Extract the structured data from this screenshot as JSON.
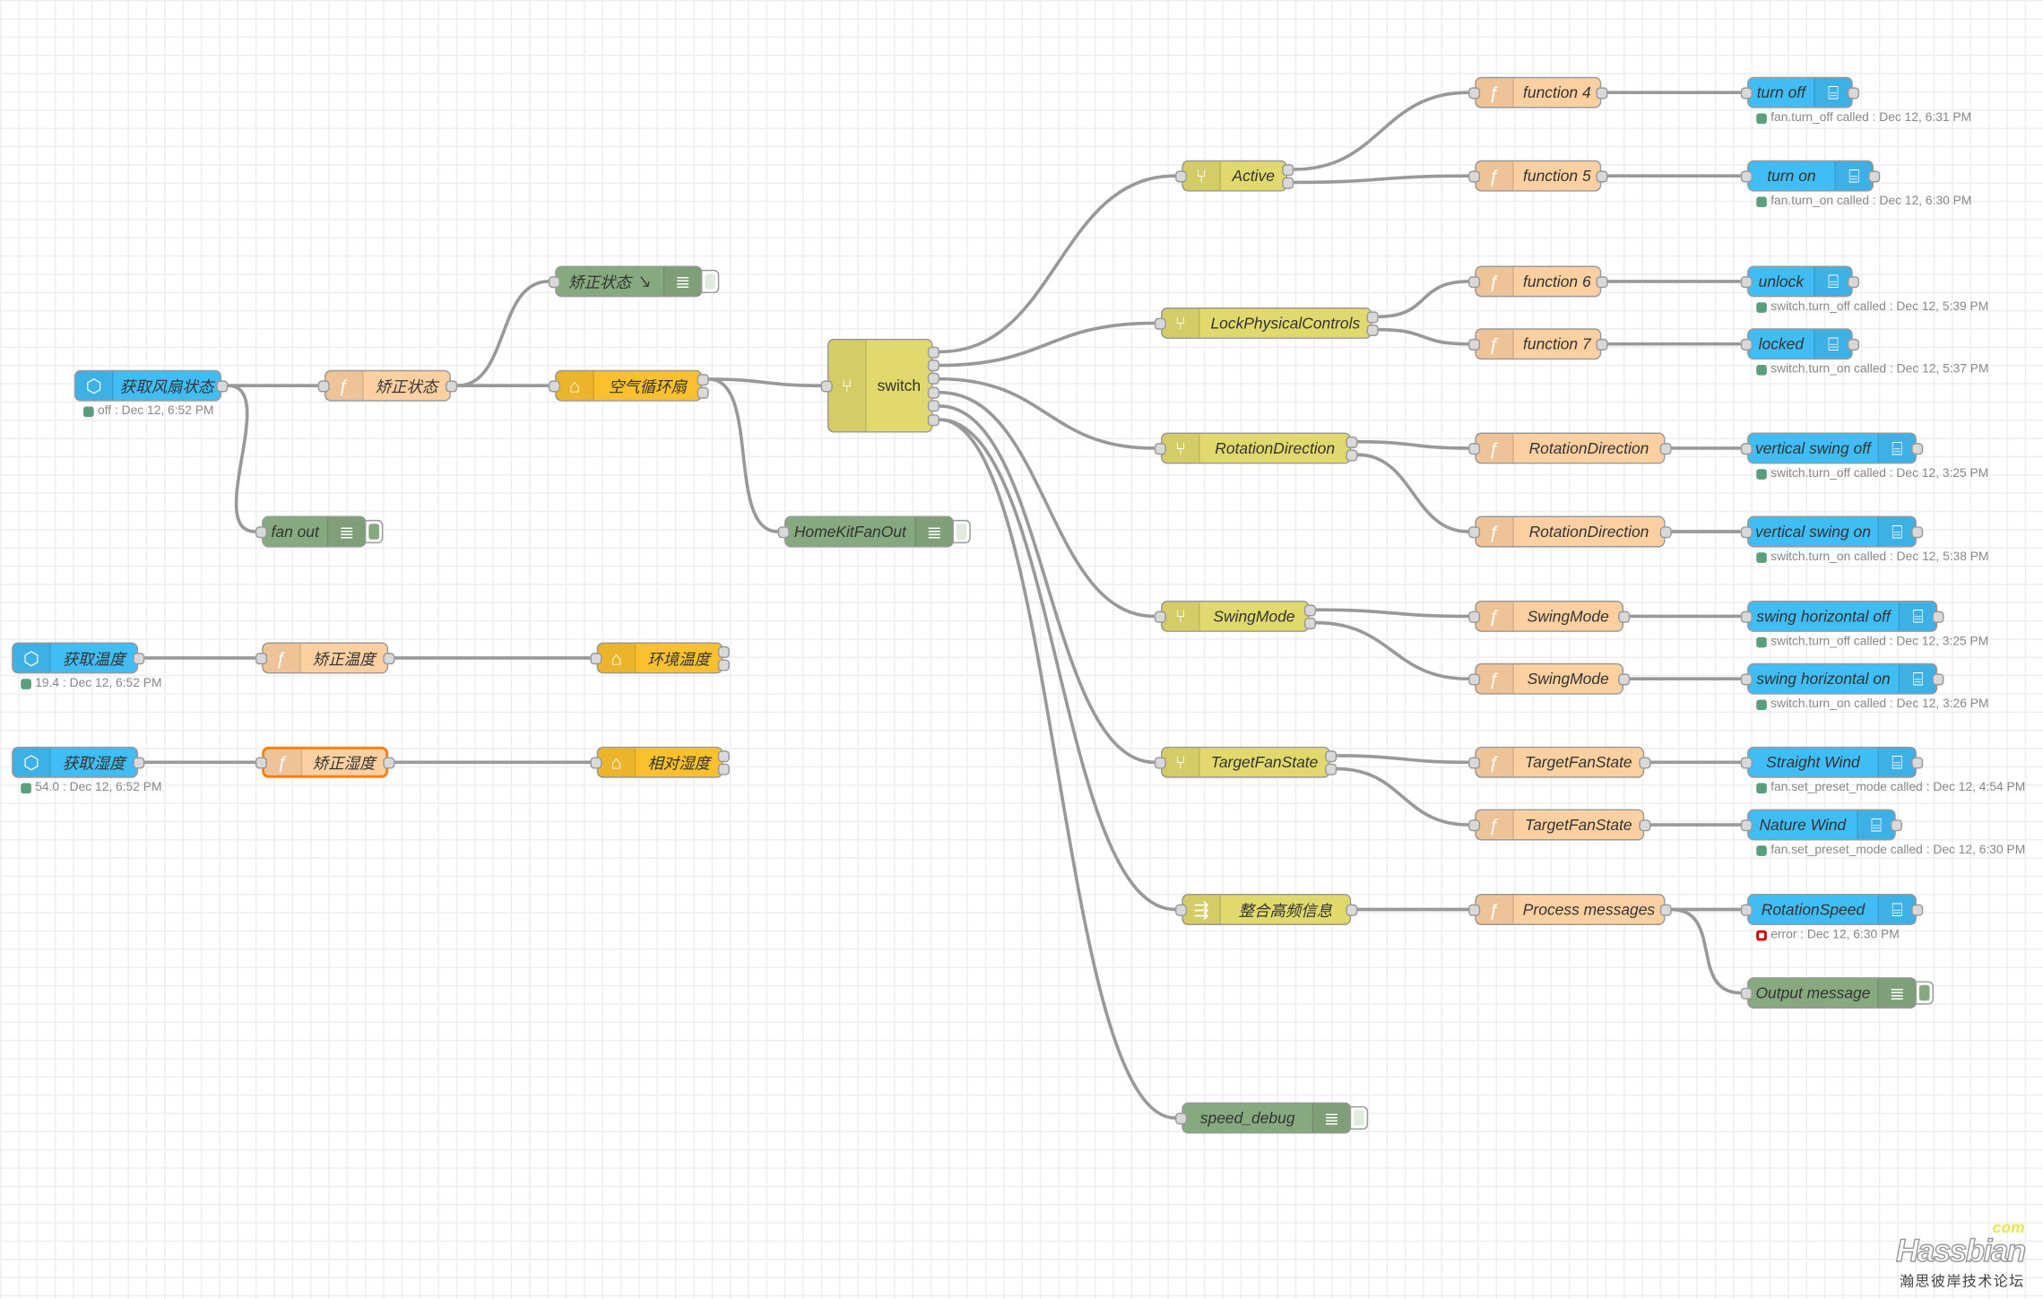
{
  "colors": {
    "ha_blue": "#41bdf5",
    "function": "#fdd0a2",
    "debug": "#87a980",
    "switch": "#e2d96e",
    "homekit": "#fbc02d",
    "wire": "#999999",
    "status_ok": "#5a9e7c",
    "status_error": "#cc0000"
  },
  "nodes": [
    {
      "id": "n1",
      "type": "ha-state",
      "icon": "ha-logo-icon",
      "label": "获取风扇状态",
      "status": "off : Dec 12, 6:52 PM",
      "status_kind": "ok"
    },
    {
      "id": "n2",
      "type": "function",
      "icon": "function-icon",
      "label": "矫正状态"
    },
    {
      "id": "n3",
      "type": "debug",
      "icon": "list-icon",
      "label": "矫正状态 ↘",
      "debug_active": false
    },
    {
      "id": "n4",
      "type": "homekit",
      "icon": "home-icon",
      "label": "空气循环扇"
    },
    {
      "id": "n5",
      "type": "debug",
      "icon": "list-icon",
      "label": "fan out",
      "debug_active": true
    },
    {
      "id": "n6",
      "type": "debug",
      "icon": "list-icon",
      "label": "HomeKitFanOut",
      "debug_active": false
    },
    {
      "id": "n7",
      "type": "ha-state",
      "icon": "ha-logo-icon",
      "label": "获取温度",
      "status": "19.4 : Dec 12, 6:52 PM",
      "status_kind": "ok"
    },
    {
      "id": "n8",
      "type": "function",
      "icon": "function-icon",
      "label": "矫正温度"
    },
    {
      "id": "n9",
      "type": "homekit",
      "icon": "home-icon",
      "label": "环境温度"
    },
    {
      "id": "n10",
      "type": "ha-state",
      "icon": "ha-logo-icon",
      "label": "获取湿度",
      "status": "54.0 : Dec 12, 6:52 PM",
      "status_kind": "ok"
    },
    {
      "id": "n11",
      "type": "function",
      "icon": "function-icon",
      "label": "矫正湿度",
      "selected": true
    },
    {
      "id": "n12",
      "type": "homekit",
      "icon": "home-icon",
      "label": "相对湿度"
    },
    {
      "id": "sw",
      "type": "switch",
      "icon": "switch-icon",
      "label": "switch"
    },
    {
      "id": "s1",
      "type": "switch",
      "icon": "switch-icon",
      "label": "Active"
    },
    {
      "id": "s2",
      "type": "switch",
      "icon": "switch-icon",
      "label": "LockPhysicalControls"
    },
    {
      "id": "s3",
      "type": "switch",
      "icon": "switch-icon",
      "label": "RotationDirection"
    },
    {
      "id": "s4",
      "type": "switch",
      "icon": "switch-icon",
      "label": "SwingMode"
    },
    {
      "id": "s5",
      "type": "switch",
      "icon": "switch-icon",
      "label": "TargetFanState"
    },
    {
      "id": "s6",
      "type": "switch",
      "icon": "join-icon",
      "label": "整合高频信息"
    },
    {
      "id": "d1",
      "type": "debug",
      "icon": "list-icon",
      "label": "speed_debug",
      "debug_active": false
    },
    {
      "id": "f4",
      "type": "function",
      "icon": "function-icon",
      "label": "function 4"
    },
    {
      "id": "f5",
      "type": "function",
      "icon": "function-icon",
      "label": "function 5"
    },
    {
      "id": "f6",
      "type": "function",
      "icon": "function-icon",
      "label": "function 6"
    },
    {
      "id": "f7",
      "type": "function",
      "icon": "function-icon",
      "label": "function 7"
    },
    {
      "id": "f8",
      "type": "function",
      "icon": "function-icon",
      "label": "RotationDirection"
    },
    {
      "id": "f9",
      "type": "function",
      "icon": "function-icon",
      "label": "RotationDirection"
    },
    {
      "id": "f10",
      "type": "function",
      "icon": "function-icon",
      "label": "SwingMode"
    },
    {
      "id": "f11",
      "type": "function",
      "icon": "function-icon",
      "label": "SwingMode"
    },
    {
      "id": "f12",
      "type": "function",
      "icon": "function-icon",
      "label": "TargetFanState"
    },
    {
      "id": "f13",
      "type": "function",
      "icon": "function-icon",
      "label": "TargetFanState"
    },
    {
      "id": "f14",
      "type": "function",
      "icon": "function-icon",
      "label": "Process messages"
    },
    {
      "id": "h1",
      "type": "ha-service",
      "icon": "router-icon",
      "label": "turn off",
      "status": "fan.turn_off called : Dec 12, 6:31 PM",
      "status_kind": "ok"
    },
    {
      "id": "h2",
      "type": "ha-service",
      "icon": "router-icon",
      "label": "turn on",
      "status": "fan.turn_on called : Dec 12, 6:30 PM",
      "status_kind": "ok"
    },
    {
      "id": "h3",
      "type": "ha-service",
      "icon": "router-icon",
      "label": "unlock",
      "status": "switch.turn_off called : Dec 12, 5:39 PM",
      "status_kind": "ok"
    },
    {
      "id": "h4",
      "type": "ha-service",
      "icon": "router-icon",
      "label": "locked",
      "status": "switch.turn_on called : Dec 12, 5:37 PM",
      "status_kind": "ok"
    },
    {
      "id": "h5",
      "type": "ha-service",
      "icon": "router-icon",
      "label": "vertical swing off",
      "status": "switch.turn_off called : Dec 12, 3:25 PM",
      "status_kind": "ok"
    },
    {
      "id": "h6",
      "type": "ha-service",
      "icon": "router-icon",
      "label": "vertical swing on",
      "status": "switch.turn_on called : Dec 12, 5:38 PM",
      "status_kind": "ok"
    },
    {
      "id": "h7",
      "type": "ha-service",
      "icon": "router-icon",
      "label": "swing horizontal off",
      "status": "switch.turn_off called : Dec 12, 3:25 PM",
      "status_kind": "ok"
    },
    {
      "id": "h8",
      "type": "ha-service",
      "icon": "router-icon",
      "label": "swing horizontal on",
      "status": "switch.turn_on called : Dec 12, 3:26 PM",
      "status_kind": "ok"
    },
    {
      "id": "h9",
      "type": "ha-service",
      "icon": "router-icon",
      "label": "Straight Wind",
      "status": "fan.set_preset_mode called : Dec 12, 4:54 PM",
      "status_kind": "ok"
    },
    {
      "id": "h10",
      "type": "ha-service",
      "icon": "router-icon",
      "label": "Nature Wind",
      "status": "fan.set_preset_mode called : Dec 12, 6:30 PM",
      "status_kind": "ok"
    },
    {
      "id": "h11",
      "type": "ha-service",
      "icon": "router-icon",
      "label": "RotationSpeed",
      "status": "error : Dec 12, 6:30 PM",
      "status_kind": "error"
    },
    {
      "id": "d2",
      "type": "debug",
      "icon": "list-icon",
      "label": "Output message",
      "debug_active": true
    }
  ],
  "watermark": {
    "brand": "Hassbian",
    "suffix": "com",
    "subtitle": "瀚思彼岸技术论坛"
  }
}
